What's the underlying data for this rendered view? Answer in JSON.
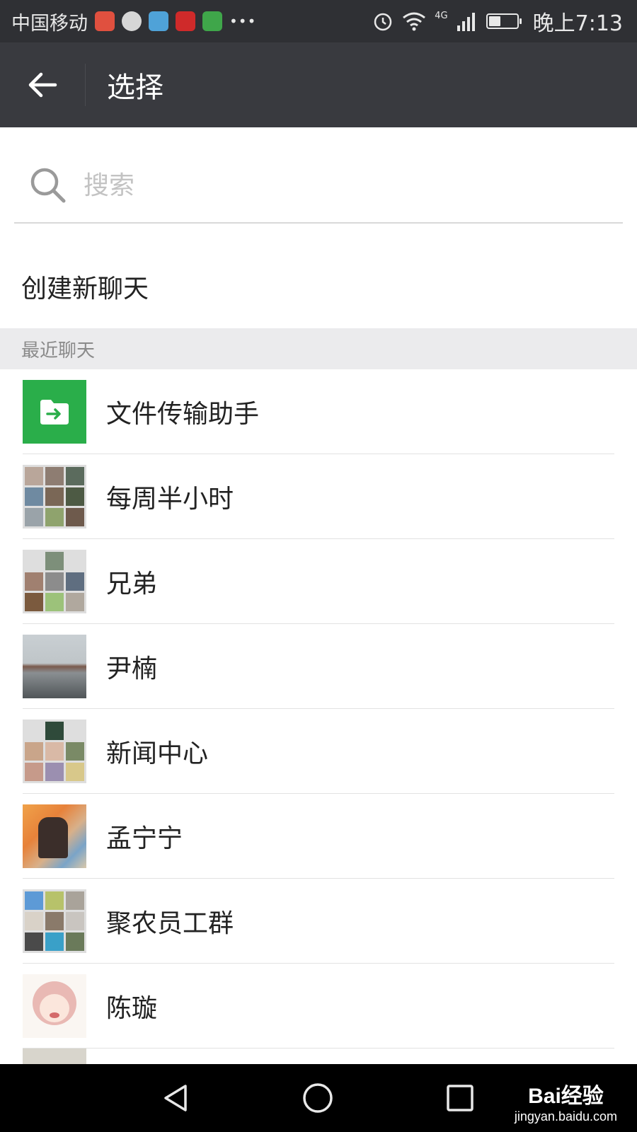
{
  "status_bar": {
    "carrier": "中国移动",
    "time": "晚上7:13",
    "network": "4G"
  },
  "app_bar": {
    "title": "选择"
  },
  "search": {
    "placeholder": "搜索"
  },
  "create_chat": {
    "label": "创建新聊天"
  },
  "recent": {
    "header": "最近聊天",
    "items": [
      {
        "name": "文件传输助手",
        "avatar": "file-transfer"
      },
      {
        "name": "每周半小时",
        "avatar": "group-grid"
      },
      {
        "name": "兄弟",
        "avatar": "group-grid"
      },
      {
        "name": "尹楠",
        "avatar": "photo"
      },
      {
        "name": "新闻中心",
        "avatar": "group-grid"
      },
      {
        "name": "孟宁宁",
        "avatar": "photo"
      },
      {
        "name": "聚农员工群",
        "avatar": "group-grid"
      },
      {
        "name": "陈璇",
        "avatar": "anime"
      }
    ]
  },
  "watermark": {
    "brand": "Bai经验",
    "url": "jingyan.baidu.com"
  },
  "colors": {
    "accent": "#2aae4a",
    "app_bar": "#393a3f",
    "status_bar": "#2f3034"
  }
}
